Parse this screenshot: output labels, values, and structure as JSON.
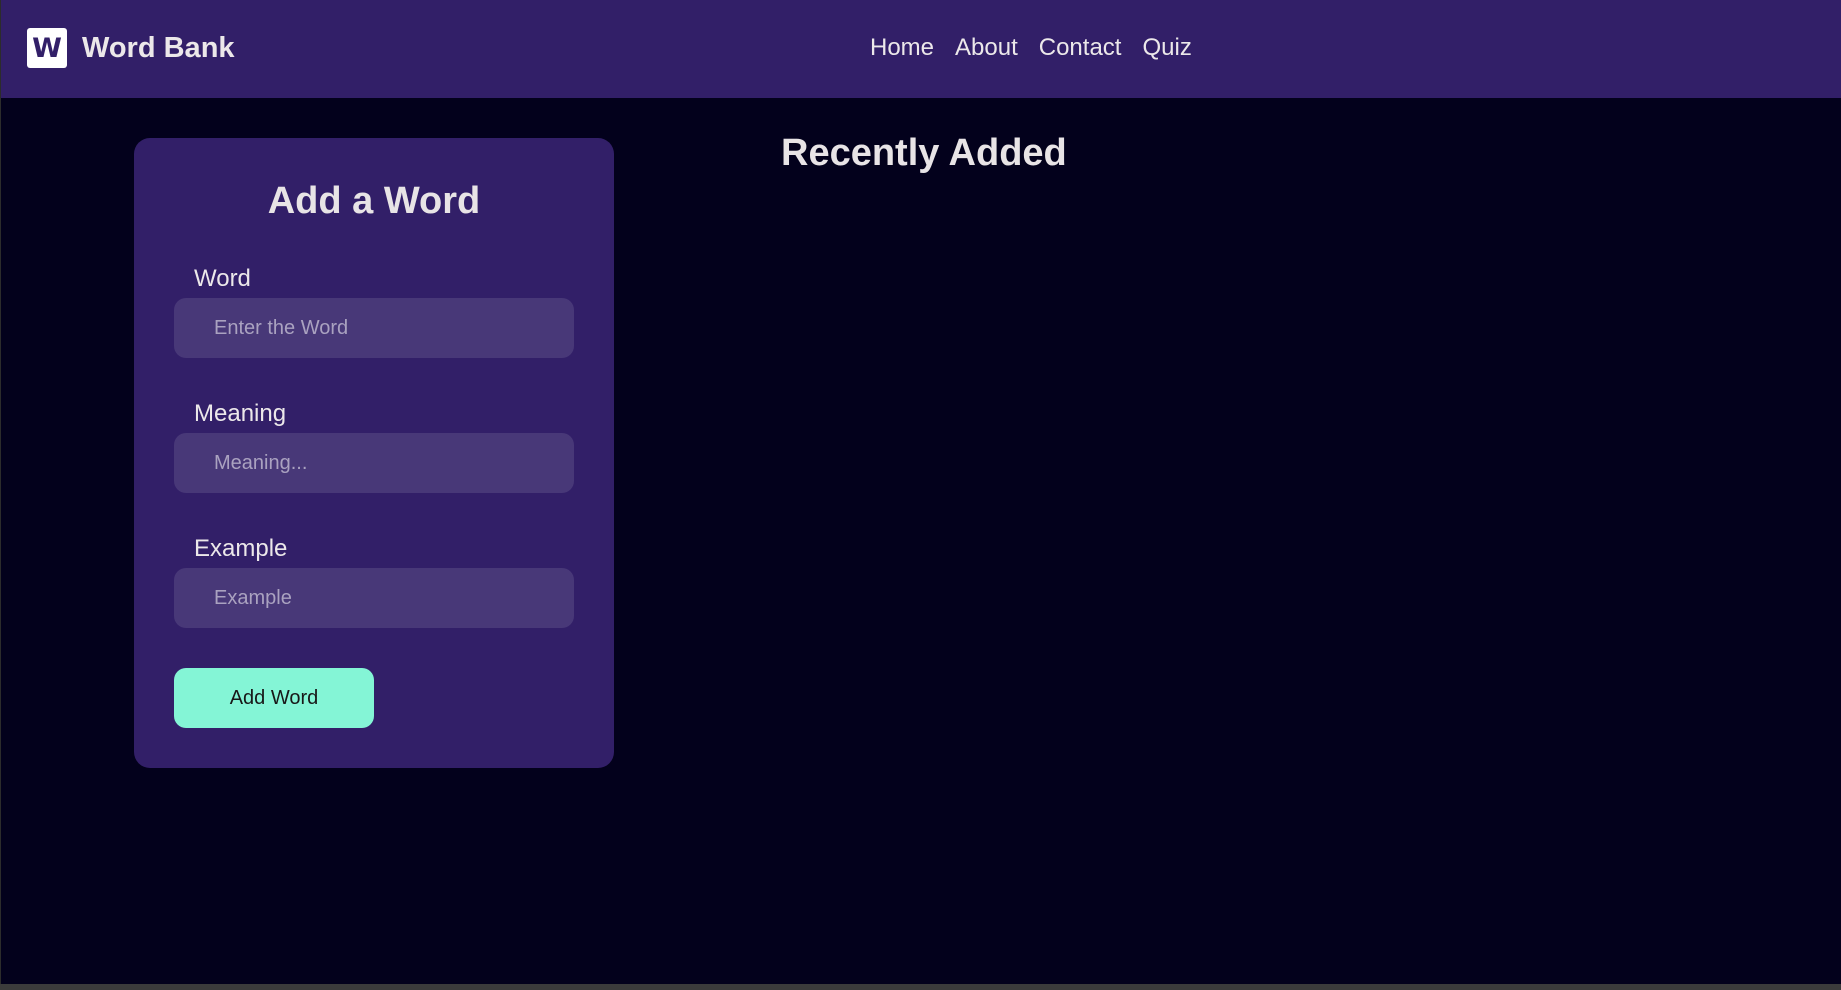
{
  "navbar": {
    "logo_letter": "W",
    "brand_name": "Word Bank",
    "links": [
      "Home",
      "About",
      "Contact",
      "Quiz"
    ]
  },
  "form": {
    "title": "Add a Word",
    "fields": [
      {
        "label": "Word",
        "placeholder": "Enter the Word",
        "value": ""
      },
      {
        "label": "Meaning",
        "placeholder": "Meaning...",
        "value": ""
      },
      {
        "label": "Example",
        "placeholder": "Example",
        "value": ""
      }
    ],
    "submit_label": "Add Word"
  },
  "recent": {
    "title": "Recently Added",
    "items": []
  },
  "colors": {
    "navbar_bg": "#321f68",
    "page_bg": "#03011c",
    "card_bg": "#321f68",
    "input_bg": "#483878",
    "accent": "#84f5d6",
    "text": "#ece8ea"
  }
}
